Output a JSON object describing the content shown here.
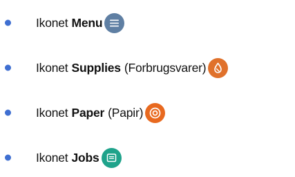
{
  "items": [
    {
      "prefix": "Ikonet",
      "name": "Menu",
      "suffix": "",
      "icon": "menu-icon",
      "icon_color": "#5f7fa3"
    },
    {
      "prefix": "Ikonet",
      "name": "Supplies",
      "suffix": "(Forbrugsvarer)",
      "icon": "supplies-drop-icon",
      "icon_color": "#e0712b"
    },
    {
      "prefix": "Ikonet",
      "name": "Paper",
      "suffix": "(Papir)",
      "icon": "paper-roll-icon",
      "icon_color": "#e8691f"
    },
    {
      "prefix": "Ikonet",
      "name": "Jobs",
      "suffix": "",
      "icon": "jobs-icon",
      "icon_color": "#1fa38b"
    }
  ]
}
